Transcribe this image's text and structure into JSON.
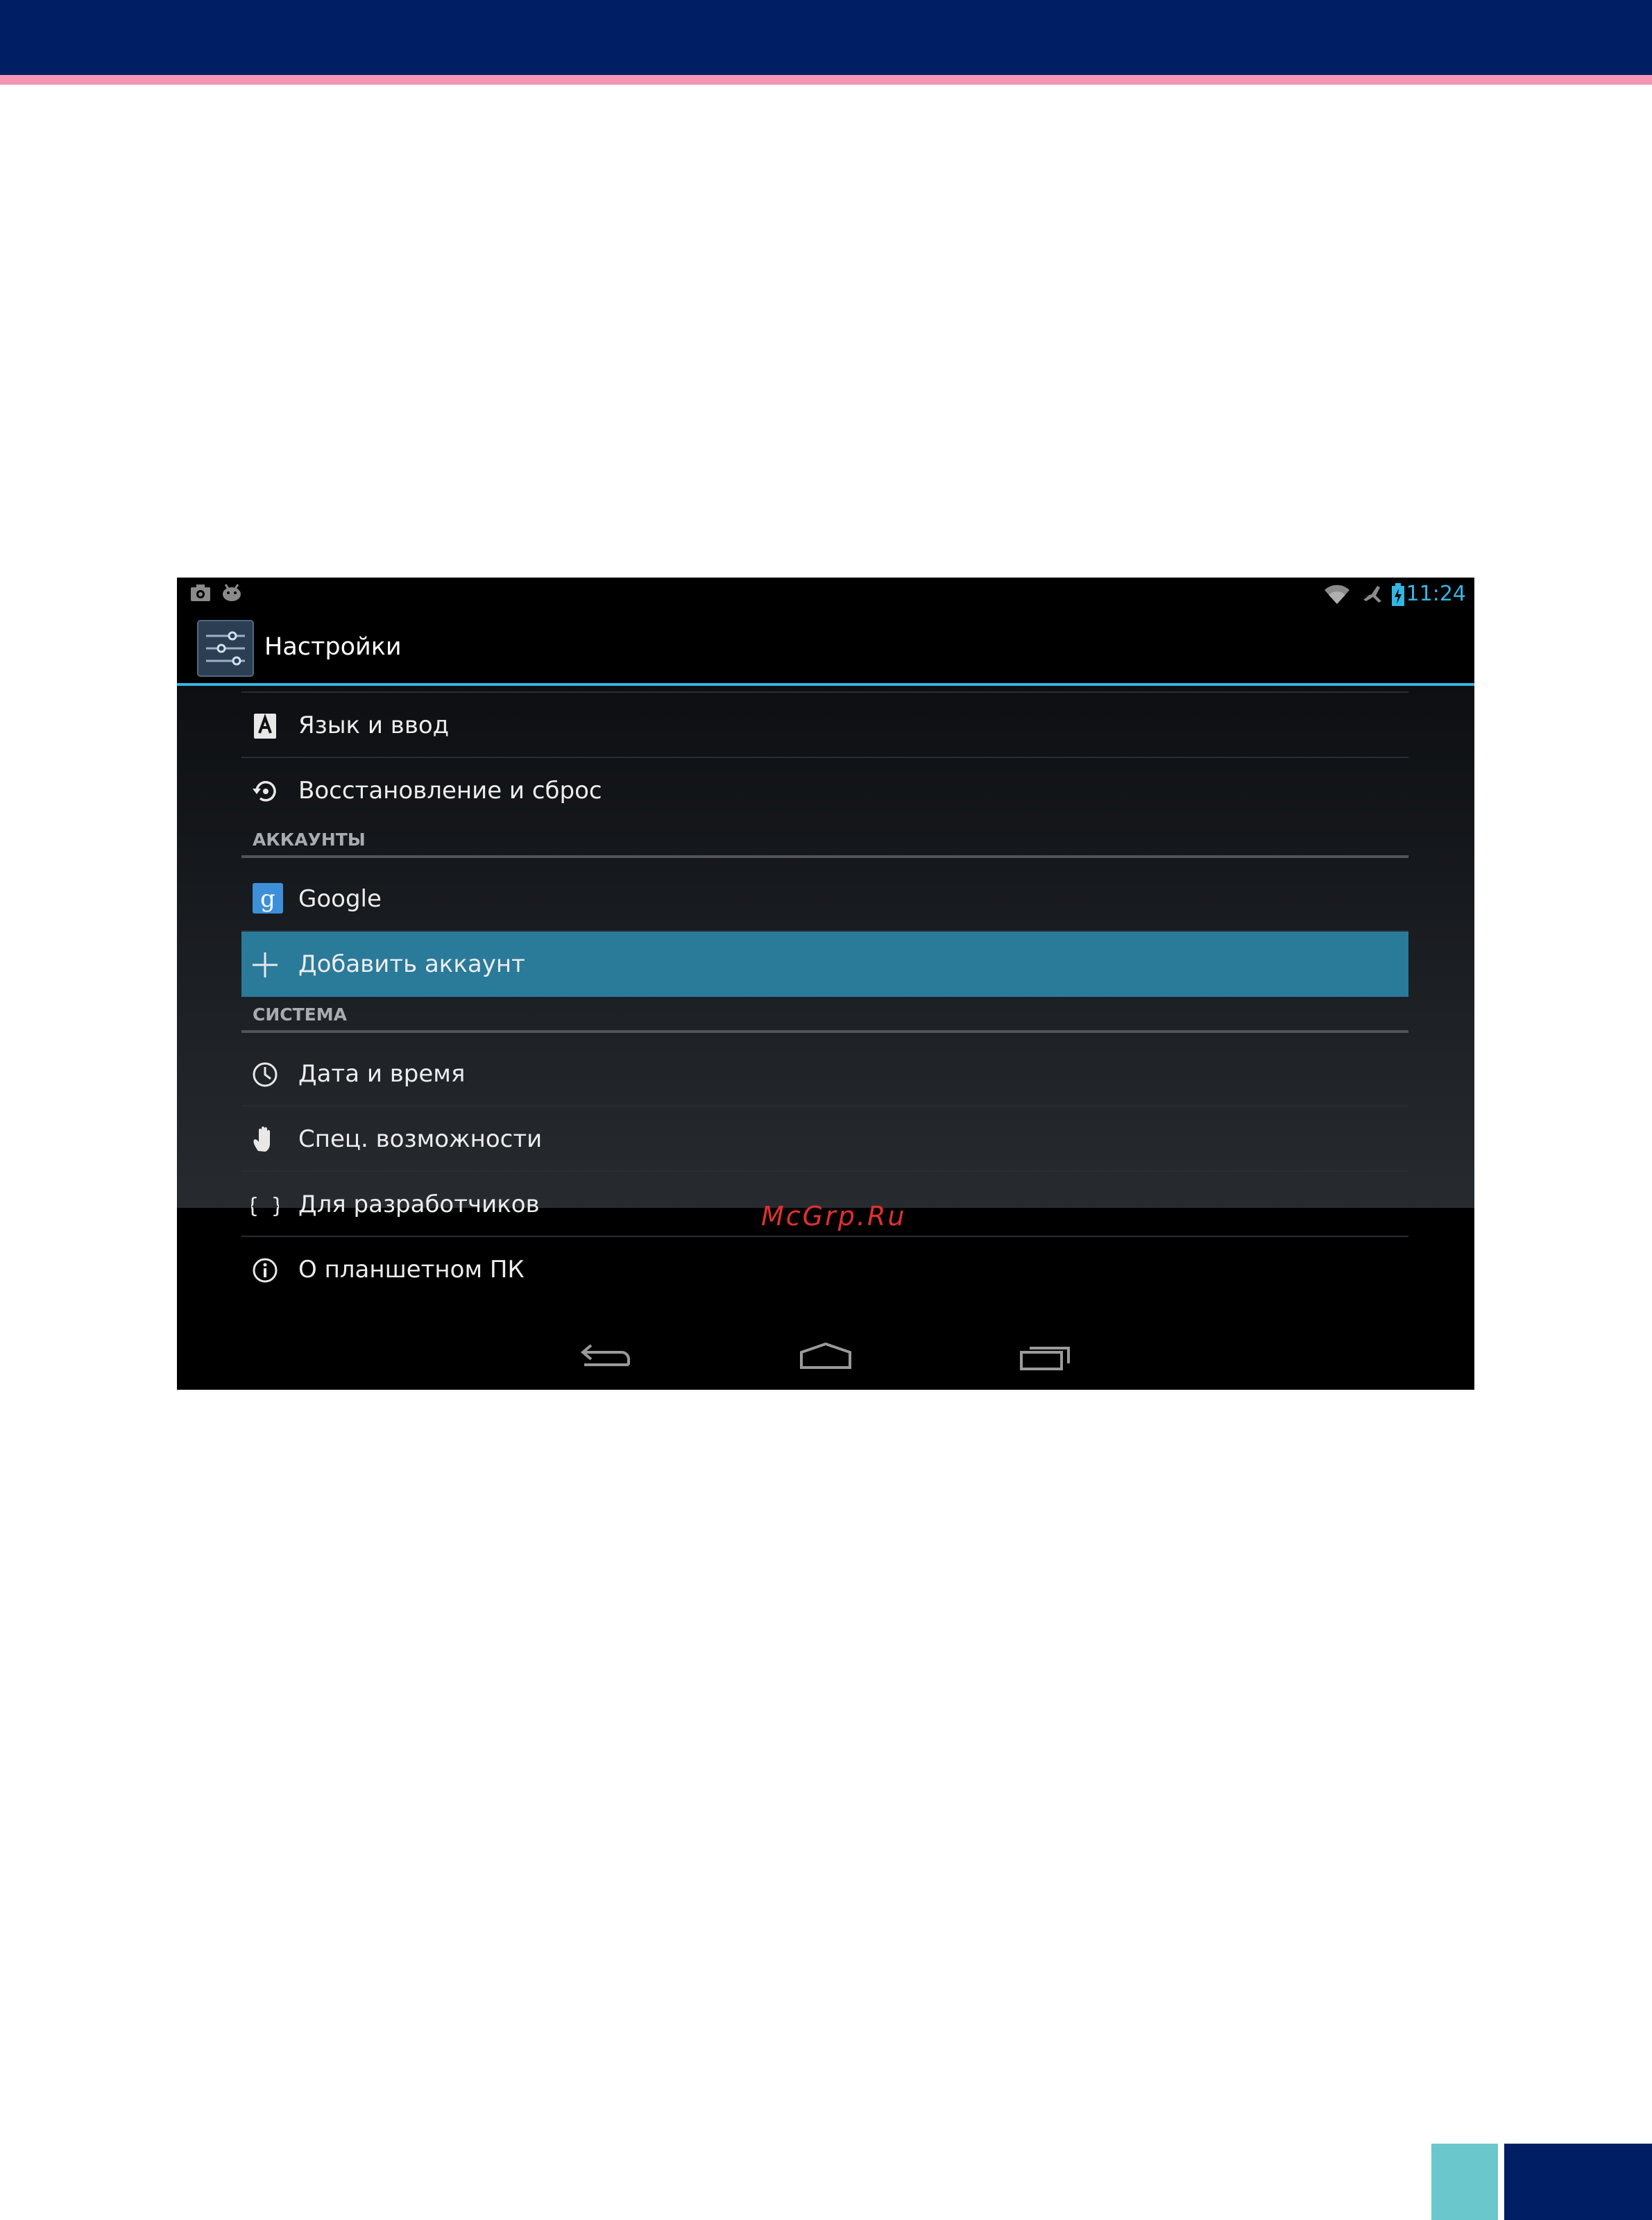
{
  "colors": {
    "header_navy": "#001e64",
    "stripe_pink": "#f296b4",
    "corner_teal": "#6ac8cc",
    "holo_blue": "#33b5e5",
    "selected_row": "#2a7a9a"
  },
  "status_bar": {
    "left_icons": [
      "screenshot-icon",
      "android-debug-icon"
    ],
    "right_icons": [
      "wifi-icon",
      "airplane-mode-icon",
      "battery-charging-icon"
    ],
    "time": "11:24"
  },
  "action_bar": {
    "icon": "settings-sliders-icon",
    "title": "Настройки"
  },
  "settings": {
    "rows_top": [
      {
        "icon": "language-icon",
        "label": "Язык и ввод"
      },
      {
        "icon": "backup-restore-icon",
        "label": "Восстановление и сброс"
      }
    ],
    "accounts_header": "АККАУНТЫ",
    "accounts": [
      {
        "icon": "google-icon",
        "label": "Google"
      },
      {
        "icon": "plus-icon",
        "label": "Добавить аккаунт",
        "selected": true
      }
    ],
    "system_header": "СИСТЕМА",
    "system": [
      {
        "icon": "clock-icon",
        "label": "Дата и время"
      },
      {
        "icon": "hand-icon",
        "label": "Спец. возможности"
      },
      {
        "icon": "braces-icon",
        "label": "Для разработчиков"
      },
      {
        "icon": "info-icon",
        "label": "О планшетном ПК"
      }
    ]
  },
  "watermark": "McGrp.Ru",
  "nav_bar": {
    "buttons": [
      "back-icon",
      "home-icon",
      "recent-apps-icon"
    ]
  }
}
